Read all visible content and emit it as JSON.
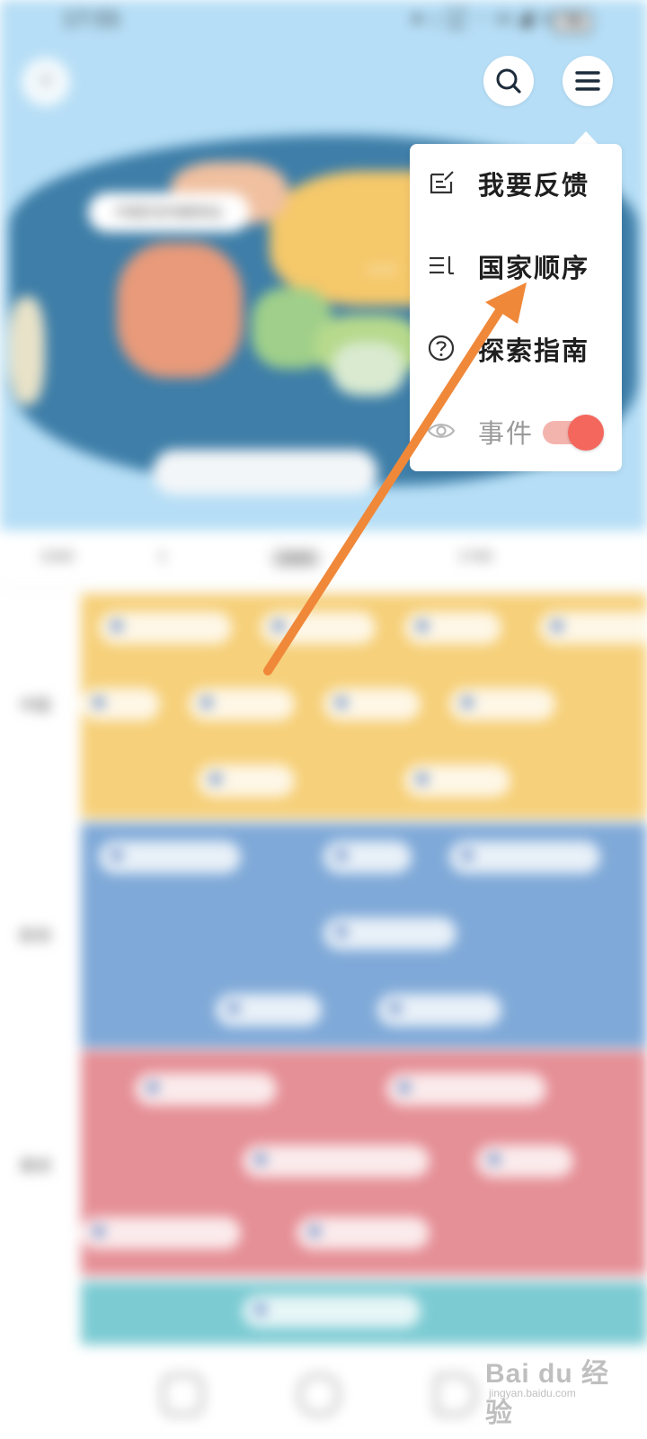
{
  "status_bar": {
    "time": "17:55",
    "net_speed_value": "5.4",
    "net_speed_unit": "K/s",
    "network_1": "4G",
    "network_2": "5G",
    "battery": "78"
  },
  "map": {
    "label": "中国历史地图地址",
    "ocean_label": "太平洋"
  },
  "timeline_tabs": [
    "1500",
    "1",
    "1600",
    "1700"
  ],
  "row_labels": [
    "中国",
    "欧洲",
    "美洲"
  ],
  "menu": {
    "items": [
      {
        "label": "我要反馈",
        "icon": "edit-note-icon"
      },
      {
        "label": "国家顺序",
        "icon": "list-order-icon"
      },
      {
        "label": "探索指南",
        "icon": "help-circle-icon"
      },
      {
        "label": "事件",
        "icon": "eye-icon",
        "toggle_on": true
      }
    ]
  },
  "colors": {
    "sky": "#b6def6",
    "toggle_on": "#f4675d",
    "arrow": "#f0883a",
    "band_yellow": "#f6d07a",
    "band_blue": "#7fa9d8",
    "band_red": "#e58f96",
    "band_teal": "#7ccbd3"
  },
  "watermark": {
    "text": "Bai du 经验",
    "sub": "jingyan.baidu.com"
  }
}
